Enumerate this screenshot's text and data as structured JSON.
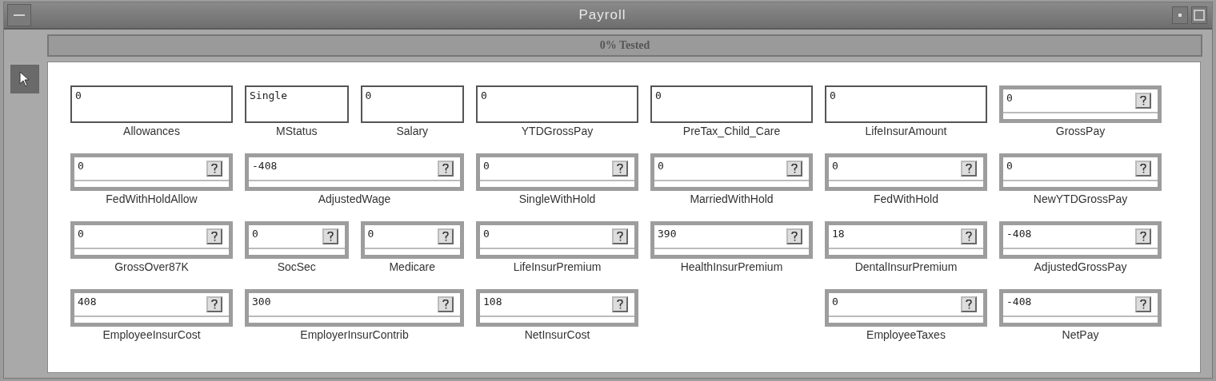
{
  "window": {
    "title": "Payroll"
  },
  "progress": {
    "label": "0% Tested",
    "level": 0
  },
  "tools": [
    {
      "kind": "pointer",
      "selected": true
    }
  ],
  "rows": [
    {
      "cells": [
        {
          "kind": "group",
          "fields": [
            {
              "label": "Allowances",
              "value": "0",
              "kind": "input"
            }
          ]
        },
        {
          "kind": "group",
          "fields": [
            {
              "label": "MStatus",
              "value": "Single",
              "kind": "input"
            },
            {
              "label": "Salary",
              "value": "0",
              "kind": "input"
            }
          ]
        },
        {
          "kind": "group",
          "fields": [
            {
              "label": "YTDGrossPay",
              "value": "0",
              "kind": "input"
            }
          ]
        },
        {
          "kind": "group",
          "fields": [
            {
              "label": "PreTax_Child_Care",
              "value": "0",
              "kind": "input"
            }
          ]
        },
        {
          "kind": "group",
          "fields": [
            {
              "label": "LifeInsurAmount",
              "value": "0",
              "kind": "input"
            }
          ]
        },
        {
          "kind": "group",
          "fields": [
            {
              "label": "GrossPay",
              "value": "0",
              "kind": "computed"
            }
          ]
        }
      ]
    },
    {
      "cells": [
        {
          "kind": "group",
          "fields": [
            {
              "label": "FedWithHoldAllow",
              "value": "0",
              "kind": "computed"
            }
          ]
        },
        {
          "kind": "group",
          "fields": [
            {
              "label": "AdjustedWage",
              "value": "-408",
              "kind": "computed"
            }
          ]
        },
        {
          "kind": "group",
          "fields": [
            {
              "label": "SingleWithHold",
              "value": "0",
              "kind": "computed"
            }
          ]
        },
        {
          "kind": "group",
          "fields": [
            {
              "label": "MarriedWithHold",
              "value": "0",
              "kind": "computed"
            }
          ]
        },
        {
          "kind": "group",
          "fields": [
            {
              "label": "FedWithHold",
              "value": "0",
              "kind": "computed"
            }
          ]
        },
        {
          "kind": "group",
          "fields": [
            {
              "label": "NewYTDGrossPay",
              "value": "0",
              "kind": "computed"
            }
          ]
        }
      ]
    },
    {
      "cells": [
        {
          "kind": "group",
          "fields": [
            {
              "label": "GrossOver87K",
              "value": "0",
              "kind": "computed"
            }
          ]
        },
        {
          "kind": "group",
          "fields": [
            {
              "label": "SocSec",
              "value": "0",
              "kind": "computed"
            },
            {
              "label": "Medicare",
              "value": "0",
              "kind": "computed"
            }
          ]
        },
        {
          "kind": "group",
          "fields": [
            {
              "label": "LifeInsurPremium",
              "value": "0",
              "kind": "computed"
            }
          ]
        },
        {
          "kind": "group",
          "fields": [
            {
              "label": "HealthInsurPremium",
              "value": "390",
              "kind": "computed"
            }
          ]
        },
        {
          "kind": "group",
          "fields": [
            {
              "label": "DentalInsurPremium",
              "value": "18",
              "kind": "computed"
            }
          ]
        },
        {
          "kind": "group",
          "fields": [
            {
              "label": "AdjustedGrossPay",
              "value": "-408",
              "kind": "computed"
            }
          ]
        }
      ]
    },
    {
      "cells": [
        {
          "kind": "group",
          "fields": [
            {
              "label": "EmployeeInsurCost",
              "value": "408",
              "kind": "computed"
            }
          ]
        },
        {
          "kind": "group",
          "fields": [
            {
              "label": "EmployerInsurContrib",
              "value": "300",
              "kind": "computed"
            }
          ]
        },
        {
          "kind": "group",
          "fields": [
            {
              "label": "NetInsurCost",
              "value": "108",
              "kind": "computed"
            }
          ]
        },
        {
          "kind": "empty"
        },
        {
          "kind": "group",
          "fields": [
            {
              "label": "EmployeeTaxes",
              "value": "0",
              "kind": "computed"
            }
          ]
        },
        {
          "kind": "group",
          "fields": [
            {
              "label": "NetPay",
              "value": "-408",
              "kind": "computed"
            }
          ]
        }
      ]
    }
  ]
}
